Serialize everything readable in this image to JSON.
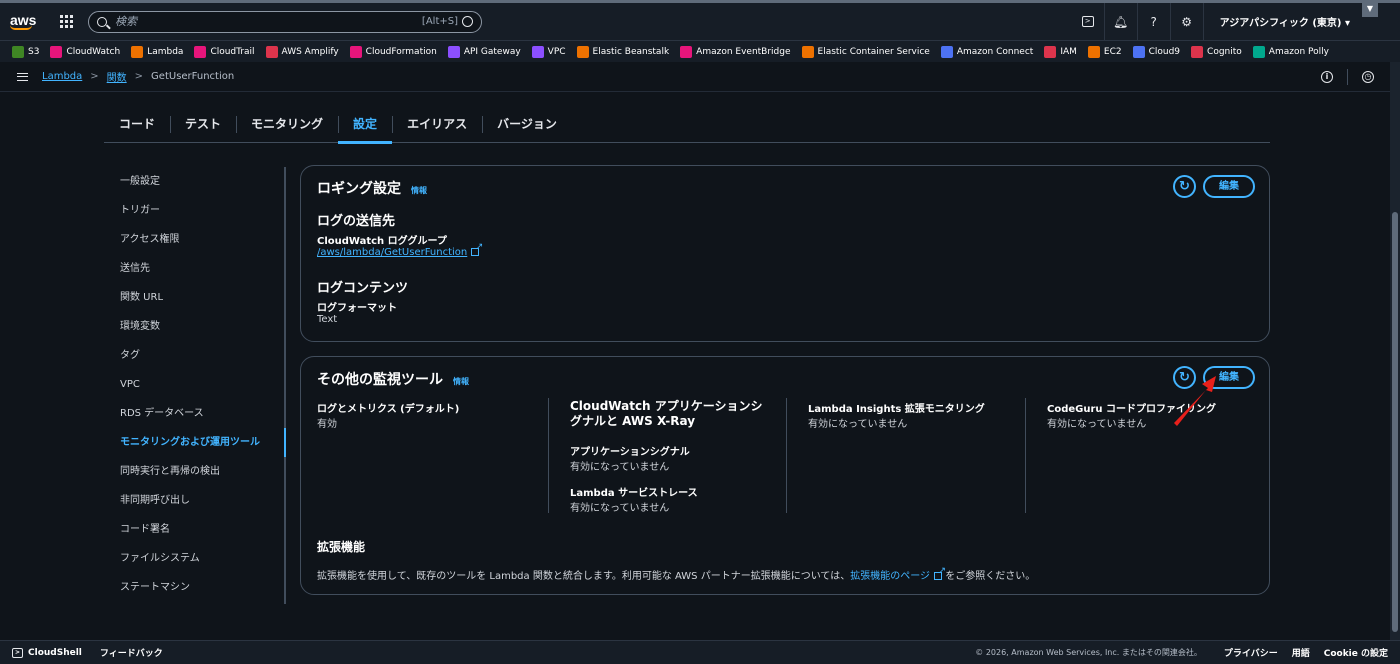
{
  "topbar": {
    "logo": "aws",
    "search_placeholder": "検索",
    "search_shortcut": "[Alt+S]",
    "region": "アジアパシフィック (東京) ▾"
  },
  "favorites": [
    {
      "label": "S3",
      "color": "#3f8624"
    },
    {
      "label": "CloudWatch",
      "color": "#e7157b"
    },
    {
      "label": "Lambda",
      "color": "#ed7100"
    },
    {
      "label": "CloudTrail",
      "color": "#e7157b"
    },
    {
      "label": "AWS Amplify",
      "color": "#dd344c"
    },
    {
      "label": "CloudFormation",
      "color": "#e7157b"
    },
    {
      "label": "API Gateway",
      "color": "#8c4fff"
    },
    {
      "label": "VPC",
      "color": "#8c4fff"
    },
    {
      "label": "Elastic Beanstalk",
      "color": "#ed7100"
    },
    {
      "label": "Amazon EventBridge",
      "color": "#e7157b"
    },
    {
      "label": "Elastic Container Service",
      "color": "#ed7100"
    },
    {
      "label": "Amazon Connect",
      "color": "#4d72f3"
    },
    {
      "label": "IAM",
      "color": "#dd344c"
    },
    {
      "label": "EC2",
      "color": "#ed7100"
    },
    {
      "label": "Cloud9",
      "color": "#4d72f3"
    },
    {
      "label": "Cognito",
      "color": "#dd344c"
    },
    {
      "label": "Amazon Polly",
      "color": "#01a88d"
    }
  ],
  "breadcrumb": {
    "items": [
      "Lambda",
      "関数"
    ],
    "current": "GetUserFunction"
  },
  "tabs": [
    "コード",
    "テスト",
    "モニタリング",
    "設定",
    "エイリアス",
    "バージョン"
  ],
  "active_tab": "設定",
  "sidenav": [
    "一般設定",
    "トリガー",
    "アクセス権限",
    "送信先",
    "関数 URL",
    "環境変数",
    "タグ",
    "VPC",
    "RDS データベース",
    "モニタリングおよび運用ツール",
    "同時実行と再帰の検出",
    "非同期呼び出し",
    "コード署名",
    "ファイルシステム",
    "ステートマシン"
  ],
  "logging": {
    "title": "ロギング設定",
    "info": "情報",
    "edit": "編集",
    "dest_title": "ログの送信先",
    "group_label": "CloudWatch ロググループ",
    "group_value": "/aws/lambda/GetUserFunction",
    "content_title": "ログコンテンツ",
    "format_label": "ログフォーマット",
    "format_value": "Text"
  },
  "monitoring": {
    "title": "その他の監視ツール",
    "info": "情報",
    "edit": "編集",
    "col1_label": "ログとメトリクス (デフォルト)",
    "col1_value": "有効",
    "col2_title": "CloudWatch アプリケーションシグナルと AWS X-Ray",
    "col2_sub1_label": "アプリケーションシグナル",
    "col2_sub1_value": "有効になっていません",
    "col2_sub2_label": "Lambda サービストレース",
    "col2_sub2_value": "有効になっていません",
    "col3_label": "Lambda Insights 拡張モニタリング",
    "col3_value": "有効になっていません",
    "col4_label": "CodeGuru コードプロファイリング",
    "col4_value": "有効になっていません",
    "ext_title": "拡張機能",
    "ext_text": "拡張機能を使用して、既存のツールを Lambda 関数と統合します。利用可能な AWS パートナー拡張機能については、",
    "ext_link": "拡張機能のページ",
    "ext_text2": "をご参照ください。"
  },
  "footer": {
    "cloudshell": "CloudShell",
    "feedback": "フィードバック",
    "copyright": "© 2026, Amazon Web Services, Inc. またはその関連会社。",
    "privacy": "プライバシー",
    "terms": "用語",
    "cookie": "Cookie の設定"
  }
}
